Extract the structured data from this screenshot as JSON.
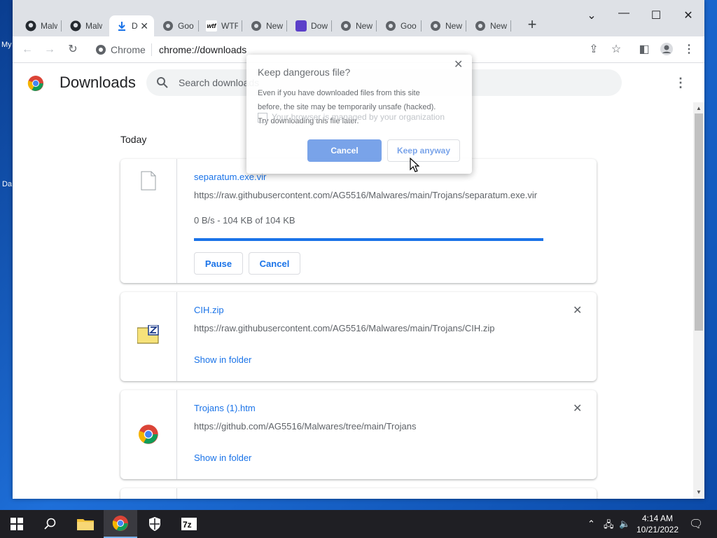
{
  "desktop": {
    "labels": [
      "My",
      "Da"
    ]
  },
  "browser": {
    "tabs": [
      {
        "title": "Malw",
        "icon": "github-icon"
      },
      {
        "title": "Malw",
        "icon": "github-icon"
      },
      {
        "title": "D",
        "icon": "download-icon",
        "active": true
      },
      {
        "title": "Goo",
        "icon": "chrome-icon"
      },
      {
        "title": "WTF",
        "icon": "wtf-icon"
      },
      {
        "title": "New",
        "icon": "chrome-icon"
      },
      {
        "title": "Dow",
        "icon": "bookmark-icon"
      },
      {
        "title": "New",
        "icon": "chrome-icon"
      },
      {
        "title": "Goo",
        "icon": "chrome-icon"
      },
      {
        "title": "New",
        "icon": "chrome-icon"
      },
      {
        "title": "New",
        "icon": "chrome-icon"
      }
    ],
    "omnibox": {
      "chip": "Chrome",
      "url": "chrome://downloads"
    }
  },
  "page": {
    "title": "Downloads",
    "search_placeholder": "Search downloads",
    "date_label": "Today",
    "downloads": [
      {
        "name": "separatum.exe.vir",
        "url": "https://raw.githubusercontent.com/AG5516/Malwares/main/Trojans/separatum.exe.vir",
        "status": "0 B/s - 104 KB of 104 KB",
        "progress": 1.0,
        "buttons": [
          "Pause",
          "Cancel"
        ]
      },
      {
        "name": "CIH.zip",
        "url": "https://raw.githubusercontent.com/AG5516/Malwares/main/Trojans/CIH.zip",
        "link": "Show in folder"
      },
      {
        "name": "Trojans (1).htm",
        "url": "https://github.com/AG5516/Malwares/tree/main/Trojans",
        "link": "Show in folder"
      }
    ]
  },
  "dialog": {
    "title": "Keep dangerous file?",
    "body_line1": "Even if you have downloaded files from this site",
    "body_line2": "before, the site may be temporarily unsafe (hacked).",
    "body_line3": "Try downloading this file later.",
    "ghost_text": "Your browser is managed by your organization",
    "cancel": "Cancel",
    "keep": "Keep anyway"
  },
  "taskbar": {
    "time": "4:14 AM",
    "date": "10/21/2022"
  }
}
